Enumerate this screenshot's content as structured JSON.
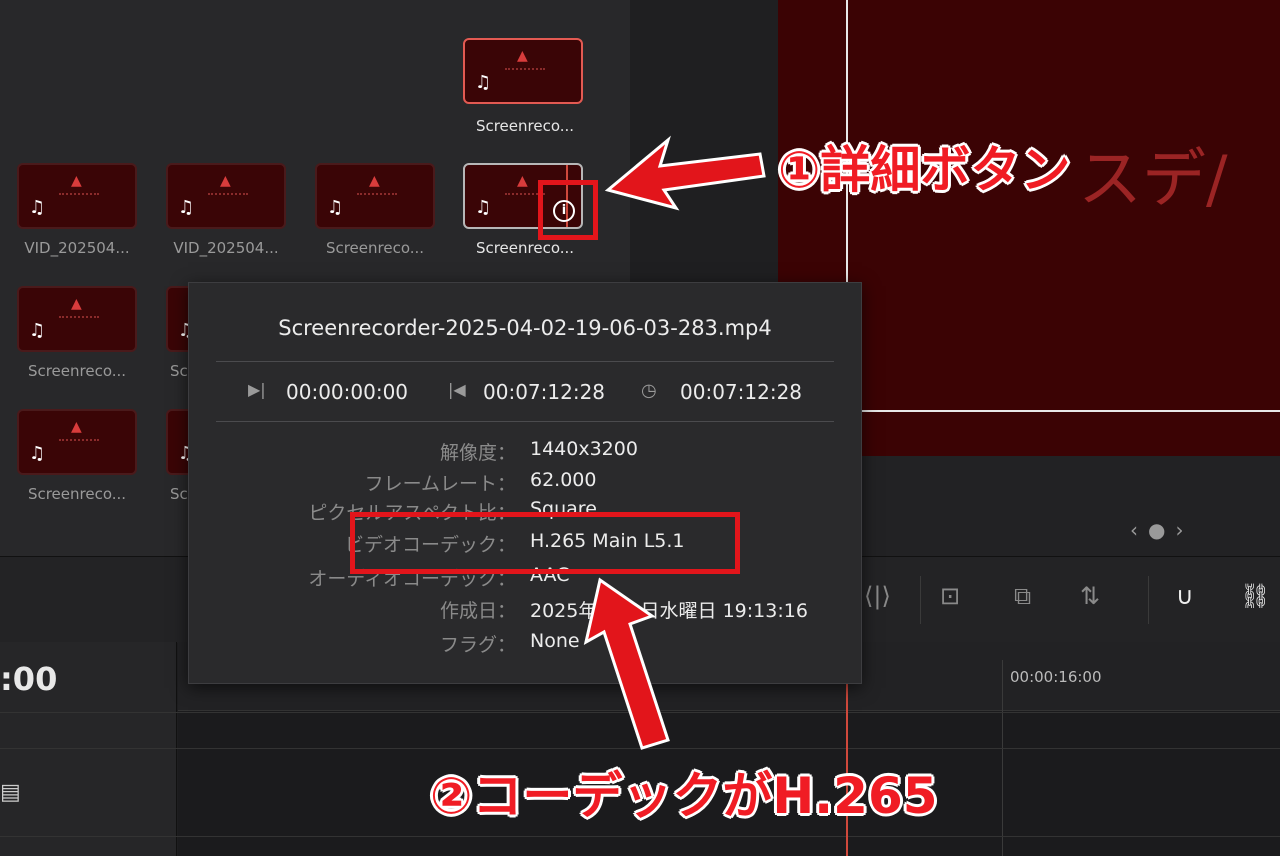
{
  "media_pool": {
    "clips": [
      {
        "label": "Screenreco..."
      },
      {
        "label": "VID_202504..."
      },
      {
        "label": "VID_202504..."
      },
      {
        "label": "Screenreco..."
      },
      {
        "label": "Screenreco..."
      },
      {
        "label": "Screenreco..."
      },
      {
        "label": "Sc"
      },
      {
        "label": "Screenreco..."
      },
      {
        "label": "Sc"
      }
    ]
  },
  "viewer": {
    "overlay_text": "スデ/"
  },
  "popup": {
    "title": "Screenrecorder-2025-04-02-19-06-03-283.mp4",
    "in_time": "00:00:00:00",
    "out_time": "00:07:12:28",
    "duration": "00:07:12:28",
    "rows": [
      {
        "label": "解像度：",
        "value": "1440x3200"
      },
      {
        "label": "フレームレート：",
        "value": "62.000"
      },
      {
        "label": "ピクセルアスペクト比：",
        "value": "Square"
      },
      {
        "label": "ビデオコーデック：",
        "value": "H.265 Main L5.1"
      },
      {
        "label": "オーディオコーデック：",
        "value": "AAC"
      },
      {
        "label": "作成日：",
        "value": "2025年4月2日水曜日 19:13:16"
      },
      {
        "label": "フラグ：",
        "value": "None"
      }
    ]
  },
  "timeline": {
    "timecode": ":00",
    "ruler_label": "00:00:16:00"
  },
  "annotations": {
    "step1": "①詳細ボタン",
    "step2": "②コーデックがH.265"
  },
  "colors": {
    "annotation_red": "#f01c24",
    "viewer_bg": "#3b0304"
  },
  "icons": {
    "info": "info-icon",
    "audio": "music-note-icon"
  }
}
